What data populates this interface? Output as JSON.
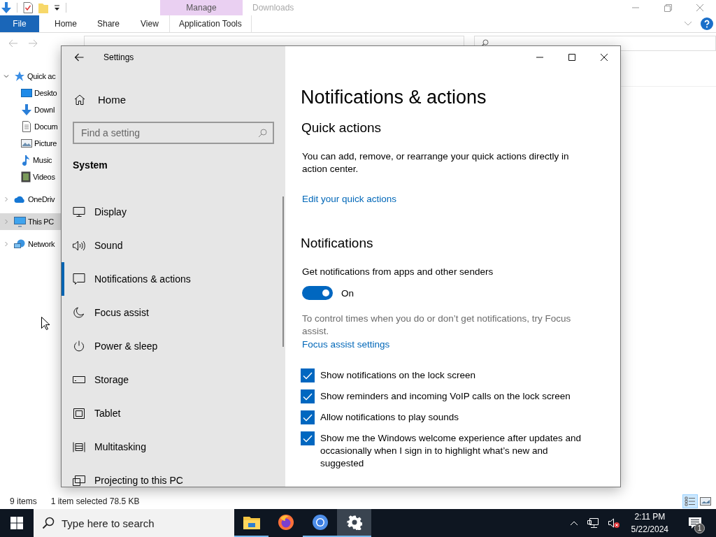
{
  "explorer": {
    "title": "Downloads",
    "contextual_group": "Manage",
    "ribbon_tabs": [
      {
        "label": "File",
        "kind": "file",
        "selected": false
      },
      {
        "label": "Home",
        "kind": "plain",
        "selected": false
      },
      {
        "label": "Share",
        "kind": "plain",
        "selected": false
      },
      {
        "label": "View",
        "kind": "plain",
        "selected": false
      },
      {
        "label": "Application Tools",
        "kind": "contextual",
        "selected": false
      }
    ],
    "nav": [
      {
        "label": "Quick ac",
        "kind": "star",
        "expanded": true,
        "selected": false,
        "children": [
          {
            "label": "Deskto",
            "kind": "desktop",
            "selected": false
          },
          {
            "label": "Downl",
            "kind": "download",
            "selected": false
          },
          {
            "label": "Docum",
            "kind": "document",
            "selected": false
          },
          {
            "label": "Picture",
            "kind": "pictures",
            "selected": false
          },
          {
            "label": "Music",
            "kind": "music",
            "selected": false
          },
          {
            "label": "Videos",
            "kind": "videos",
            "selected": false
          }
        ]
      },
      {
        "label": "OneDriv",
        "kind": "cloud",
        "expanded": false,
        "selected": false
      },
      {
        "label": "This PC",
        "kind": "computer",
        "expanded": false,
        "selected": true
      },
      {
        "label": "Network",
        "kind": "network",
        "expanded": false,
        "selected": false
      }
    ],
    "status": {
      "items": "9 items",
      "selection": "1 item selected  78.5 KB"
    },
    "views": [
      {
        "kind": "details",
        "selected": true
      },
      {
        "kind": "thumbnails",
        "selected": false
      }
    ]
  },
  "settings": {
    "title": "Settings",
    "home": "Home",
    "search": {
      "placeholder": "Find a setting"
    },
    "section": "System",
    "nav": [
      {
        "label": "Display",
        "kind": "display",
        "selected": false
      },
      {
        "label": "Sound",
        "kind": "sound",
        "selected": false
      },
      {
        "label": "Notifications & actions",
        "kind": "notifications",
        "selected": true
      },
      {
        "label": "Focus assist",
        "kind": "moon",
        "selected": false
      },
      {
        "label": "Power & sleep",
        "kind": "power",
        "selected": false
      },
      {
        "label": "Storage",
        "kind": "storage",
        "selected": false
      },
      {
        "label": "Tablet",
        "kind": "tablet",
        "selected": false
      },
      {
        "label": "Multitasking",
        "kind": "multitasking",
        "selected": false
      },
      {
        "label": "Projecting to this PC",
        "kind": "projecting",
        "selected": false
      }
    ],
    "page_title": "Notifications & actions",
    "quick_actions": {
      "heading": "Quick actions",
      "text": "You can add, remove, or rearrange your quick actions directly in action center.",
      "link": "Edit your quick actions"
    },
    "notifications": {
      "heading": "Notifications",
      "toggle": {
        "label": "Get notifications from apps and other senders",
        "on": true,
        "state": "On"
      },
      "hint": "To control times when you do or don’t get notifications, try Focus assist.",
      "link": "Focus assist settings",
      "options": [
        {
          "label": "Show notifications on the lock screen",
          "checked": true
        },
        {
          "label": "Show reminders and incoming VoIP calls on the lock screen",
          "checked": true
        },
        {
          "label": "Allow notifications to play sounds",
          "checked": true
        },
        {
          "label": "Show me the Windows welcome experience after updates and occasionally when I sign in to highlight what’s new and suggested",
          "checked": true
        }
      ]
    }
  },
  "taskbar": {
    "search": {
      "placeholder": "Type here to search"
    },
    "apps": [
      {
        "kind": "folder",
        "open": true,
        "selected": false
      },
      {
        "kind": "firefox",
        "open": false,
        "selected": false
      },
      {
        "kind": "chrome",
        "open": true,
        "selected": false
      },
      {
        "kind": "gear",
        "open": true,
        "selected": true
      }
    ],
    "time": "2:11 PM",
    "date": "5/22/2024",
    "notification_count": "1"
  }
}
